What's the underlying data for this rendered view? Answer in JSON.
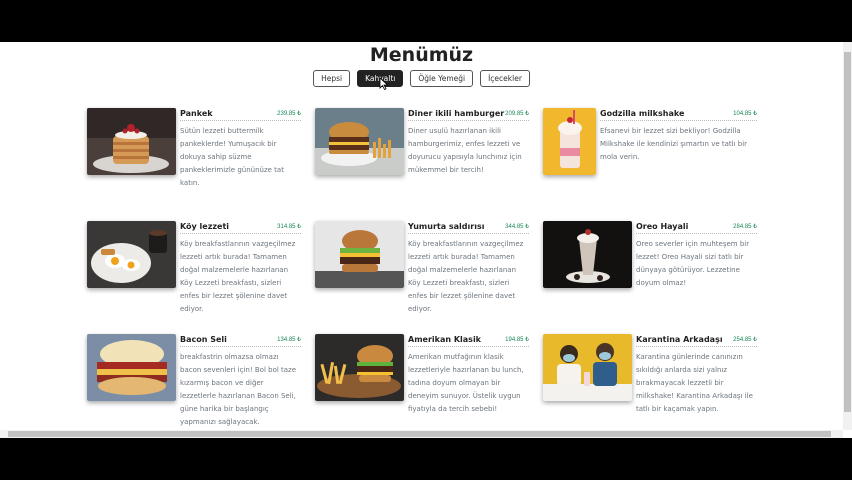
{
  "page": {
    "title": "Menümüz"
  },
  "filters": [
    {
      "label": "Hepsi",
      "active": false
    },
    {
      "label": "Kahvaltı",
      "active": true
    },
    {
      "label": "Öğle Yemeği",
      "active": false
    },
    {
      "label": "İçecekler",
      "active": false
    }
  ],
  "menu": [
    {
      "name": "Pankek",
      "price": "239.85 ₺",
      "desc": "Sütün lezzeti buttermilk pankeklerde! Yumuşacık bir dokuya sahip süzme pankeklerimizle gününüze tat katın.",
      "image": "pancake-image"
    },
    {
      "name": "Diner ikili hamburger",
      "price": "209.85 ₺",
      "desc": "Diner usulü hazırlanan ikili hamburgerimiz, enfes lezzeti ve doyurucu yapısıyla lunchınız için mükemmel bir tercih!",
      "image": "burger-image"
    },
    {
      "name": "Godzilla milkshake",
      "price": "104.85 ₺",
      "desc": "Efsanevi bir lezzet sizi bekliyor! Godzilla Milkshake ile kendinizi şımartın ve tatlı bir mola verin.",
      "image": "milkshake-image"
    },
    {
      "name": "Köy lezzeti",
      "price": "314.85 ₺",
      "desc": "Köy breakfastlarının vazgeçilmez lezzeti artık burada! Tamamen doğal malzemelerle hazırlanan Köy Lezzeti breakfastı, sizleri enfes bir lezzet şölenine davet ediyor.",
      "image": "breakfast-image"
    },
    {
      "name": "Yumurta saldırısı",
      "price": "344.85 ₺",
      "desc": "Köy breakfastlarının vazgeçilmez lezzeti artık burada! Tamamen doğal malzemelerle hazırlanan Köy Lezzeti breakfastı, sizleri enfes bir lezzet şölenine davet ediyor.",
      "image": "egg-burger-image"
    },
    {
      "name": "Oreo Hayali",
      "price": "284.85 ₺",
      "desc": "Oreo severler için muhteşem bir lezzet! Oreo Hayali sizi tatlı bir dünyaya götürüyor. Lezzetine doyum olmaz!",
      "image": "oreo-shake-image"
    },
    {
      "name": "Bacon Seli",
      "price": "134.85 ₺",
      "desc": "breakfastrin olmazsa olmazı bacon sevenleri için! Bol bol taze kızarmış bacon ve diğer lezzetlerle hazırlanan Bacon Seli, güne harika bir başlangıç yapmanızı sağlayacak.",
      "image": "bacon-sandwich-image"
    },
    {
      "name": "Amerikan Klasik",
      "price": "194.85 ₺",
      "desc": "Amerikan mutfağının klasik lezzetleriyle hazırlanan bu lunch, tadına doyum olmayan bir deneyim sunuyor. Üstelik uygun fiyatıyla da tercih sebebi!",
      "image": "burger-fries-image"
    },
    {
      "name": "Karantina Arkadaşı",
      "price": "254.85 ₺",
      "desc": "Karantina günlerinde canınızın sıkıldığı anlarda sizi yalnız bırakmayacak lezzetli bir milkshake! Karantina Arkadaşı ile tatlı bir kaçamak yapın.",
      "image": "couple-milkshake-image"
    }
  ],
  "colors": {
    "price": "#198754",
    "active_filter_bg": "#222222",
    "text_muted": "#6c757d"
  }
}
